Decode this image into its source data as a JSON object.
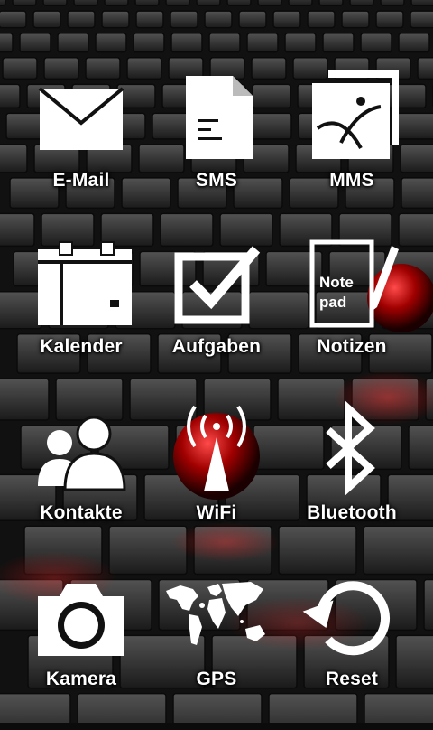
{
  "colors": {
    "accent": "#e1131c",
    "icon": "#ffffff",
    "background": "#0b0b0b"
  },
  "tiles": [
    {
      "label": "E-Mail",
      "icon": "envelope-icon"
    },
    {
      "label": "SMS",
      "icon": "document-icon"
    },
    {
      "label": "MMS",
      "icon": "picture-message-icon"
    },
    {
      "label": "Kalender",
      "icon": "calendar-icon"
    },
    {
      "label": "Aufgaben",
      "icon": "checkbox-icon"
    },
    {
      "label": "Notizen",
      "icon": "notepad-icon",
      "icon_text_line1": "Note",
      "icon_text_line2": "pad"
    },
    {
      "label": "Kontakte",
      "icon": "contacts-icon"
    },
    {
      "label": "WiFi",
      "icon": "wifi-antenna-icon"
    },
    {
      "label": "Bluetooth",
      "icon": "bluetooth-icon"
    },
    {
      "label": "Kamera",
      "icon": "camera-icon"
    },
    {
      "label": "GPS",
      "icon": "world-map-icon"
    },
    {
      "label": "Reset",
      "icon": "reset-icon"
    }
  ]
}
